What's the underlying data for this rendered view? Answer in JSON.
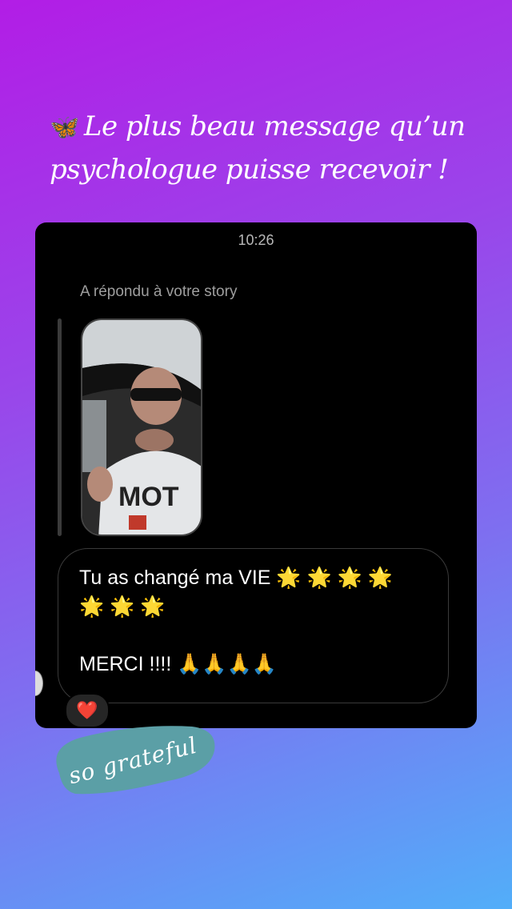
{
  "story": {
    "headline_line1": "Le plus beau message qu’un",
    "headline_line2": "psychologue puisse recevoir !",
    "sticker_text": "so grateful"
  },
  "chat": {
    "time": "10:26",
    "reply_label": "A répondu à votre story",
    "message_line1": "Tu as changé ma VIE 🌟 🌟 🌟 🌟",
    "message_line2": "🌟 🌟 🌟",
    "message_line3": "MERCI !!!! 🙏🙏🙏🙏",
    "reaction": "❤️"
  },
  "colors": {
    "gradient_top": "#b21de6",
    "gradient_bottom": "#52aef9",
    "card_background": "#000000",
    "sticker_blob": "#5b9fa6"
  },
  "icons": {
    "headline_icon": "butterfly-icon",
    "reaction_icon": "heart-icon"
  }
}
